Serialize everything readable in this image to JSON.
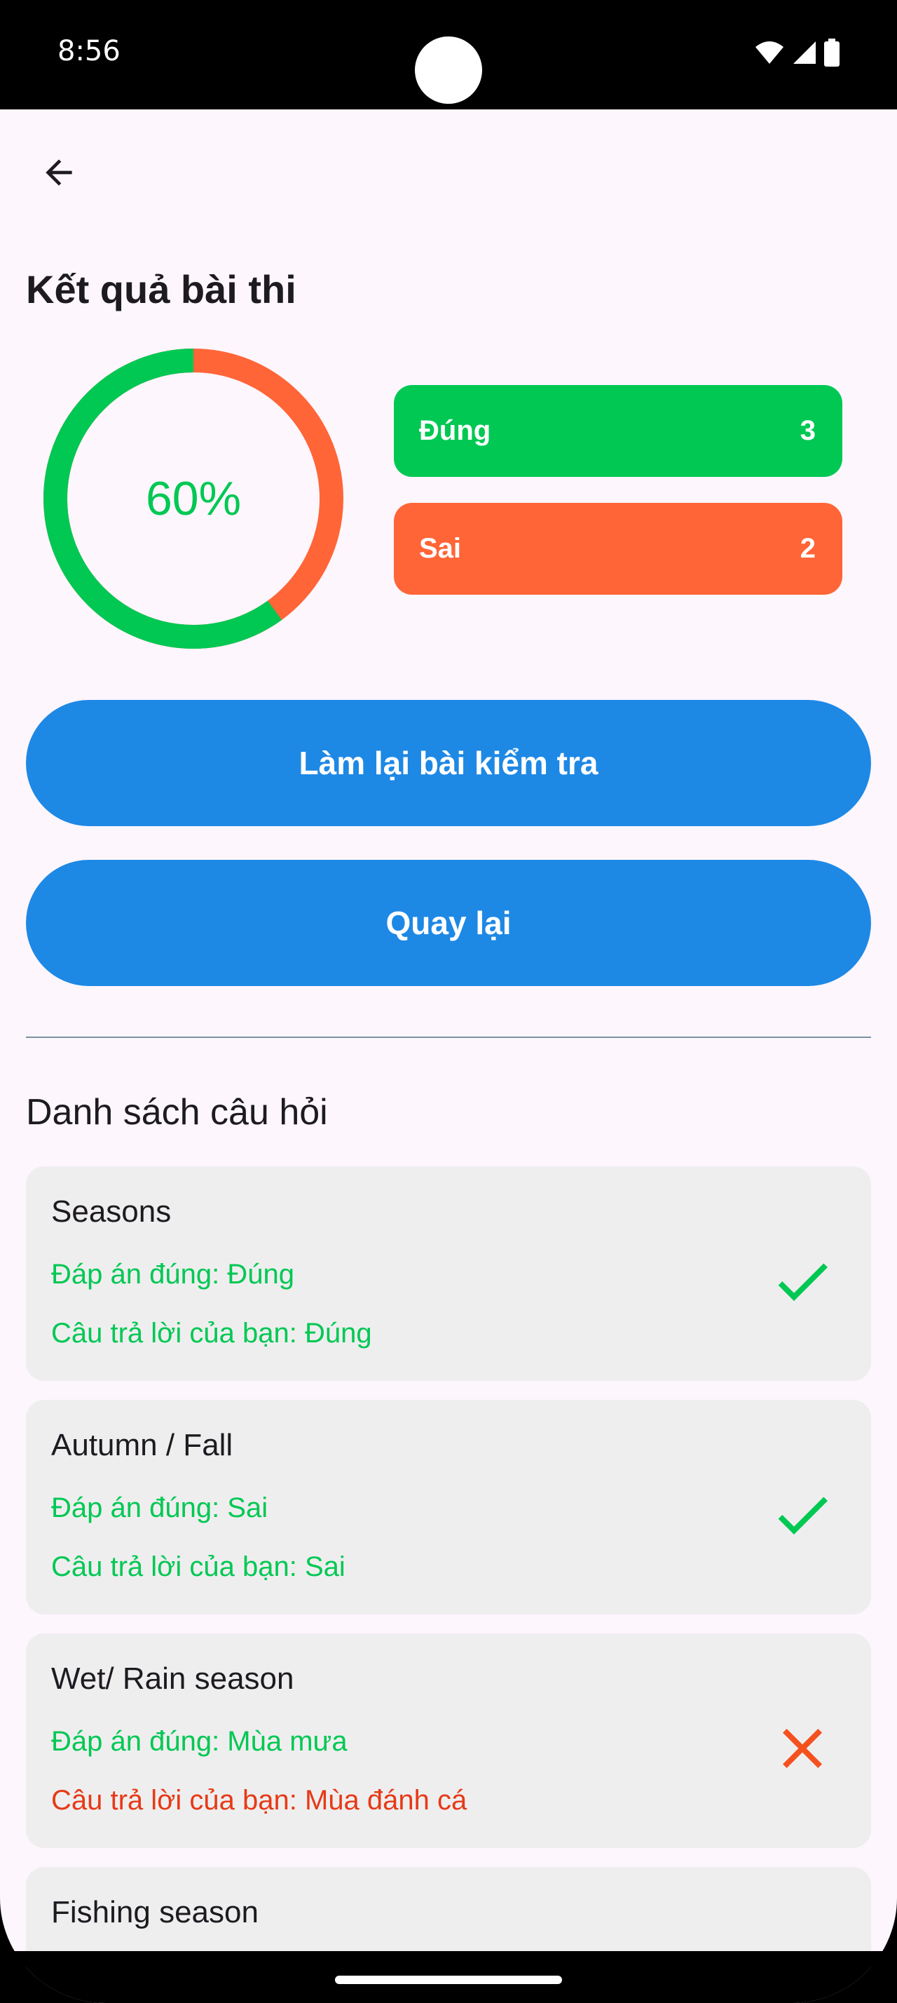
{
  "status_bar": {
    "time": "8:56",
    "icons": [
      "wifi-icon",
      "signal-icon",
      "battery-icon"
    ]
  },
  "header": {
    "back_icon": "arrow-left-icon",
    "title": "Kết quả bài thi"
  },
  "result": {
    "percent_label": "60%",
    "correct_fraction": 0.6,
    "colors": {
      "correct": "#00c853",
      "wrong": "#ff6537"
    },
    "correct": {
      "label": "Đúng",
      "count": "3"
    },
    "wrong": {
      "label": "Sai",
      "count": "2"
    }
  },
  "buttons": {
    "retry_label": "Làm lại bài kiểm tra",
    "back_label": "Quay lại",
    "color": "#1e88e5"
  },
  "questions_section": {
    "title": "Danh sách câu hỏi",
    "items": [
      {
        "title": "Seasons",
        "answer": "Đáp án đúng: Đúng",
        "user_answer": "Câu trả lời của bạn: Đúng",
        "correct": true,
        "icon": "check-icon"
      },
      {
        "title": "Autumn / Fall",
        "answer": "Đáp án đúng: Sai",
        "user_answer": "Câu trả lời của bạn: Sai",
        "correct": true,
        "icon": "check-icon"
      },
      {
        "title": "Wet/ Rain season",
        "answer": "Đáp án đúng: Mùa mưa",
        "user_answer": "Câu trả lời của bạn: Mùa đánh cá",
        "correct": false,
        "icon": "close-icon"
      },
      {
        "title": "Fishing season"
      }
    ]
  }
}
